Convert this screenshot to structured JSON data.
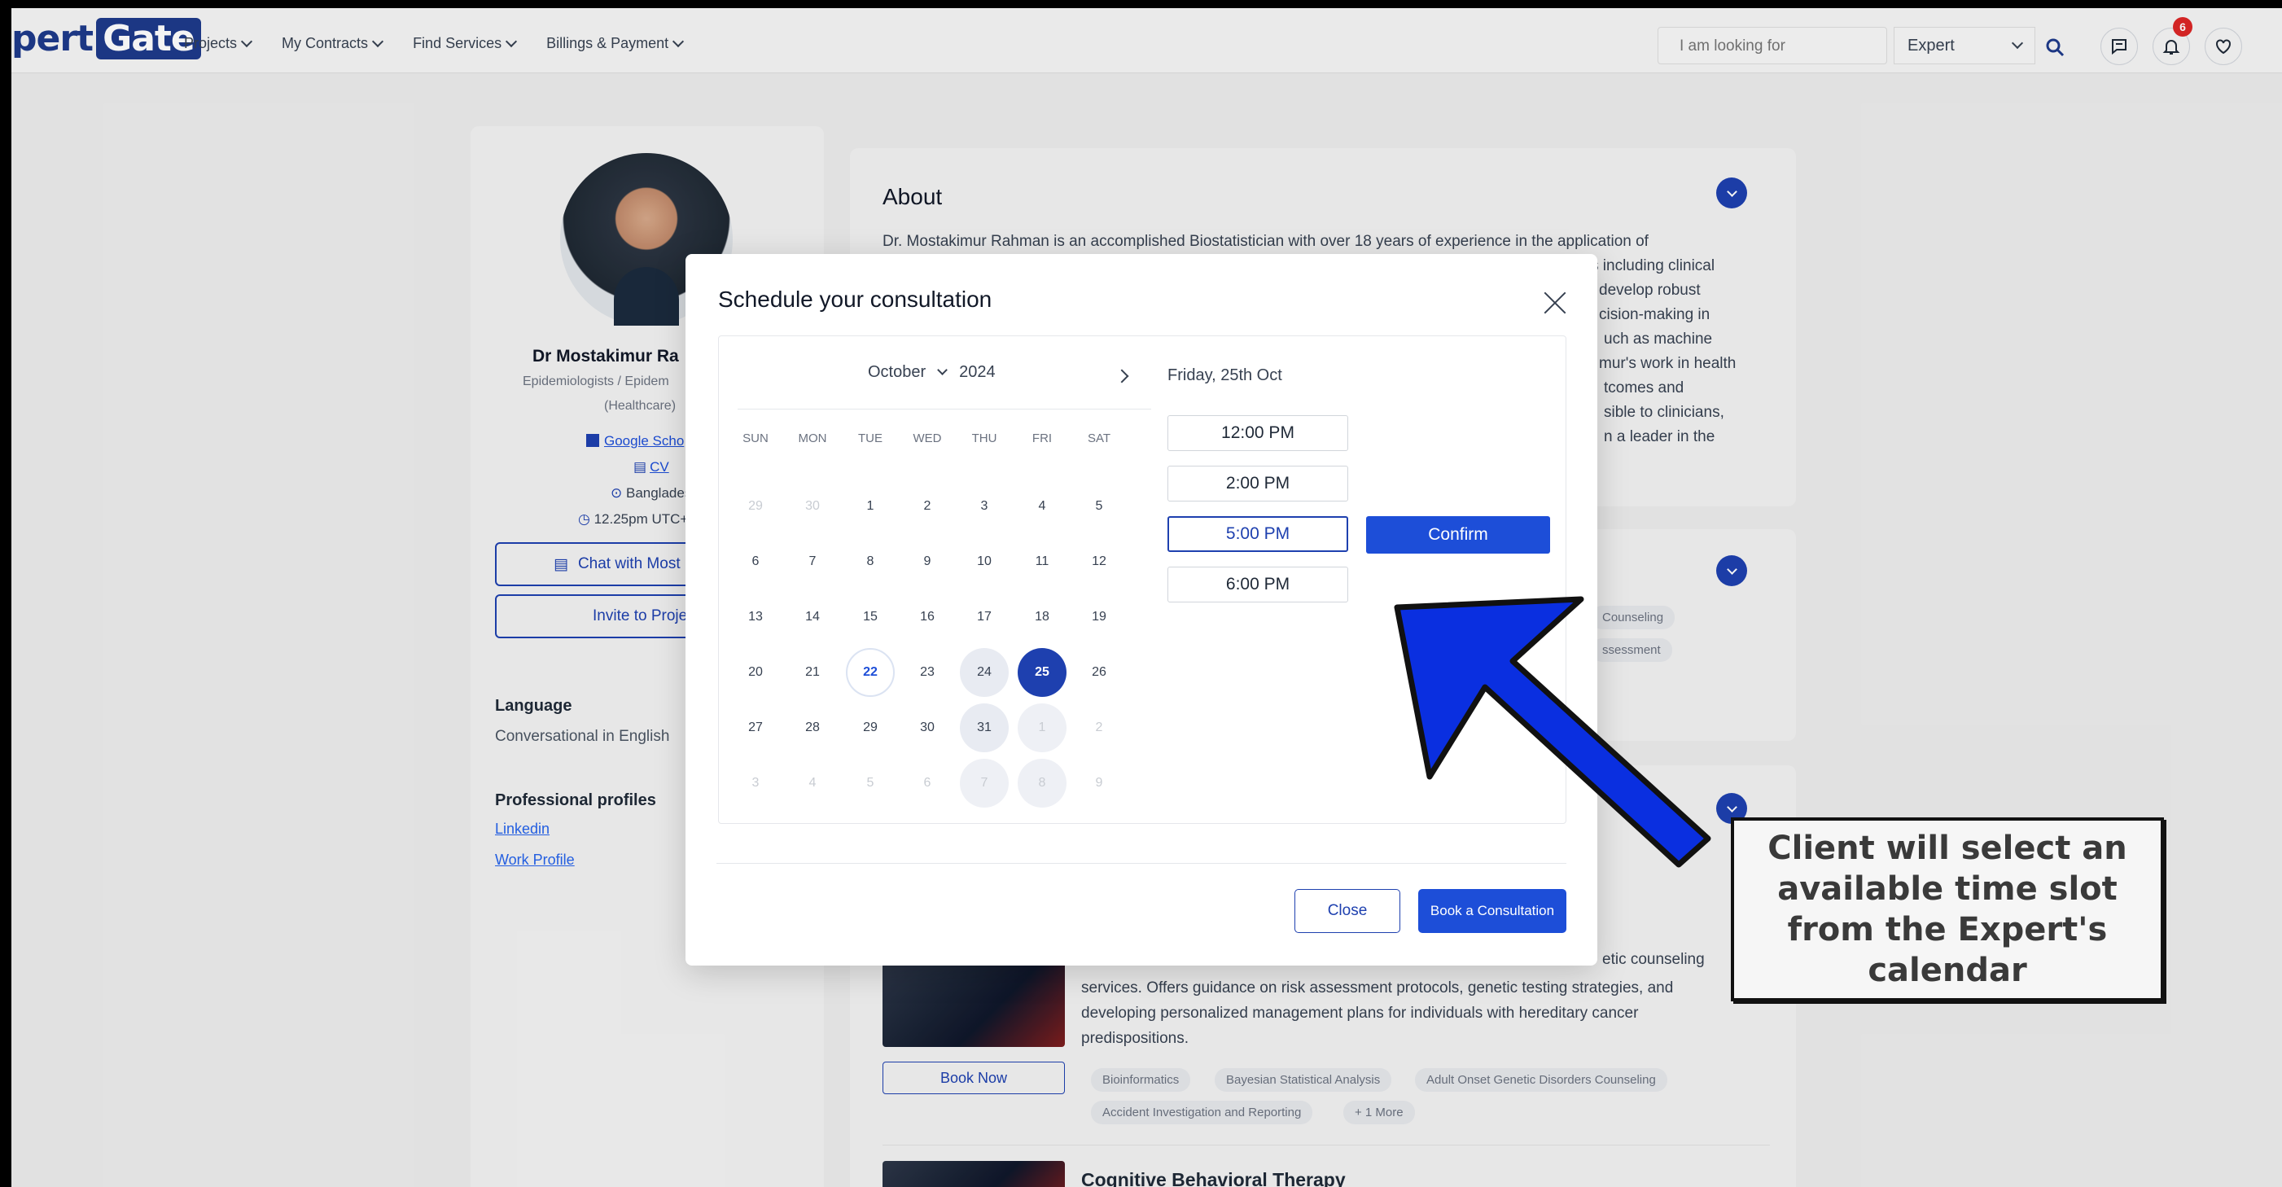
{
  "navbar": {
    "logo_left": "pert",
    "logo_right": "Gate",
    "menu": [
      {
        "label": "Projects"
      },
      {
        "label": "My Contracts"
      },
      {
        "label": "Find Services"
      },
      {
        "label": "Billings & Payment"
      }
    ],
    "search_placeholder": "I am looking for",
    "search_type": "Expert",
    "notification_count": "6"
  },
  "profile": {
    "name": "Dr Mostakimur Ra",
    "subtitle": "Epidemiologists / Epidem",
    "subtitle2": "(Healthcare)",
    "google_scholar": "Google Scho",
    "cv": "CV",
    "location": "Banglades",
    "time": "12.25pm UTC+",
    "chat_button": "Chat with Most",
    "invite_button": "Invite to Proje",
    "language_heading": "Language",
    "language_value": "Conversational in English",
    "profiles_heading": "Professional profiles",
    "linkedin": "Linkedin",
    "work_profile": "Work Profile"
  },
  "about": {
    "title": "About",
    "lines": [
      "Dr. Mostakimur Rahman is an accomplished Biostatistician with over 18 years of experience in the application of",
      "s including clinical",
      "develop robust",
      "cision-making in",
      "uch as machine",
      "mur's work in health",
      "tcomes and",
      "sible to clinicians,",
      "n a leader in the"
    ]
  },
  "card2": {
    "tags": [
      "Counseling",
      "ssessment"
    ]
  },
  "service": {
    "text_fragment": "etic counseling",
    "text_lines": [
      "services. Offers guidance on risk assessment protocols, genetic testing strategies, and",
      "developing personalized management plans for individuals with hereditary cancer",
      "predispositions."
    ],
    "book_now": "Book Now",
    "tags": [
      "Bioinformatics",
      "Bayesian Statistical Analysis",
      "Adult Onset Genetic Disorders Counseling",
      "Accident Investigation and Reporting",
      "+ 1 More"
    ],
    "next_title": "Cognitive Behavioral Therapy"
  },
  "modal": {
    "title": "Schedule your consultation",
    "month": "October",
    "year": "2024",
    "weekdays": [
      "SUN",
      "MON",
      "TUE",
      "WED",
      "THU",
      "FRI",
      "SAT"
    ],
    "weeks": [
      [
        "29",
        "30",
        "1",
        "2",
        "3",
        "4",
        "5"
      ],
      [
        "6",
        "7",
        "8",
        "9",
        "10",
        "11",
        "12"
      ],
      [
        "13",
        "14",
        "15",
        "16",
        "17",
        "18",
        "19"
      ],
      [
        "20",
        "21",
        "22",
        "23",
        "24",
        "25",
        "26"
      ],
      [
        "27",
        "28",
        "29",
        "30",
        "31",
        "1",
        "2"
      ],
      [
        "3",
        "4",
        "5",
        "6",
        "7",
        "8",
        "9"
      ]
    ],
    "selected_date_label": "Friday, 25th Oct",
    "time_slots": [
      "12:00 PM",
      "2:00 PM",
      "5:00 PM",
      "6:00 PM"
    ],
    "selected_slot": "5:00 PM",
    "confirm_label": "Confirm",
    "close_label": "Close",
    "book_label": "Book a Consultation"
  },
  "annotation": {
    "callout_text": "Client will select an available time slot from the Expert's calendar"
  },
  "colors": {
    "brand": "#1e40af",
    "accent": "#1d4ed8",
    "arrow": "#0a2fe0",
    "badge": "#dc2626"
  }
}
